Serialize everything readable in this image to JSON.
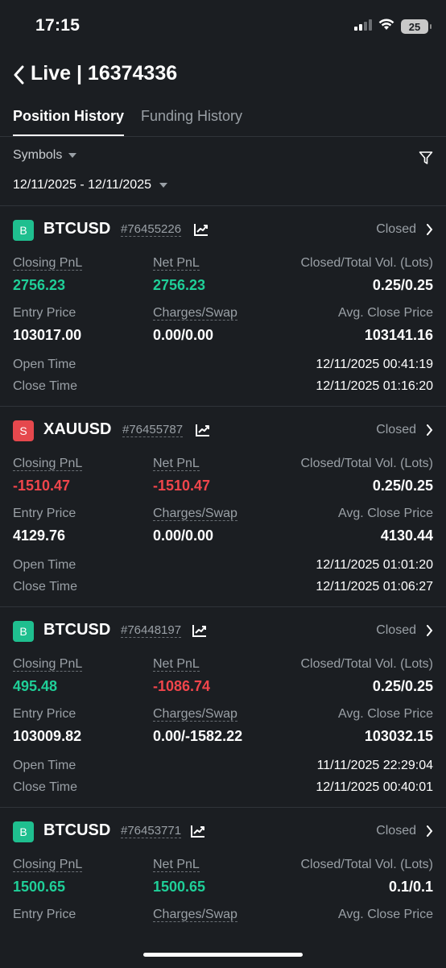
{
  "status_bar": {
    "time": "17:15",
    "battery": "25"
  },
  "header": {
    "title": "Live | 16374336"
  },
  "tabs": [
    {
      "label": "Position History",
      "active": true
    },
    {
      "label": "Funding History",
      "active": false
    }
  ],
  "filters": {
    "symbols_label": "Symbols",
    "date_range": "12/11/2025 - 12/11/2025"
  },
  "labels": {
    "closing_pnl": "Closing PnL",
    "net_pnl": "Net PnL",
    "closed_total_vol": "Closed/Total Vol. (Lots)",
    "entry_price": "Entry Price",
    "charges_swap": "Charges/Swap",
    "avg_close_price": "Avg. Close Price",
    "open_time": "Open Time",
    "close_time": "Close Time"
  },
  "colors": {
    "buy": "#1fbf8f",
    "sell": "#e5484d",
    "profit": "#1fcf98",
    "loss": "#f0454b"
  },
  "positions": [
    {
      "side": "B",
      "symbol": "BTCUSD",
      "order_id": "#76455226",
      "status": "Closed",
      "closing_pnl": "2756.23",
      "net_pnl": "2756.23",
      "volume": "0.25/0.25",
      "entry_price": "103017.00",
      "charges_swap": "0.00/0.00",
      "avg_close_price": "103141.16",
      "open_time": "12/11/2025 00:41:19",
      "close_time": "12/11/2025 01:16:20"
    },
    {
      "side": "S",
      "symbol": "XAUUSD",
      "order_id": "#76455787",
      "status": "Closed",
      "closing_pnl": "-1510.47",
      "net_pnl": "-1510.47",
      "volume": "0.25/0.25",
      "entry_price": "4129.76",
      "charges_swap": "0.00/0.00",
      "avg_close_price": "4130.44",
      "open_time": "12/11/2025 01:01:20",
      "close_time": "12/11/2025 01:06:27"
    },
    {
      "side": "B",
      "symbol": "BTCUSD",
      "order_id": "#76448197",
      "status": "Closed",
      "closing_pnl": "495.48",
      "net_pnl": "-1086.74",
      "volume": "0.25/0.25",
      "entry_price": "103009.82",
      "charges_swap": "0.00/-1582.22",
      "avg_close_price": "103032.15",
      "open_time": "11/11/2025 22:29:04",
      "close_time": "12/11/2025 00:40:01"
    },
    {
      "side": "B",
      "symbol": "BTCUSD",
      "order_id": "#76453771",
      "status": "Closed",
      "closing_pnl": "1500.65",
      "net_pnl": "1500.65",
      "volume": "0.1/0.1"
    }
  ]
}
